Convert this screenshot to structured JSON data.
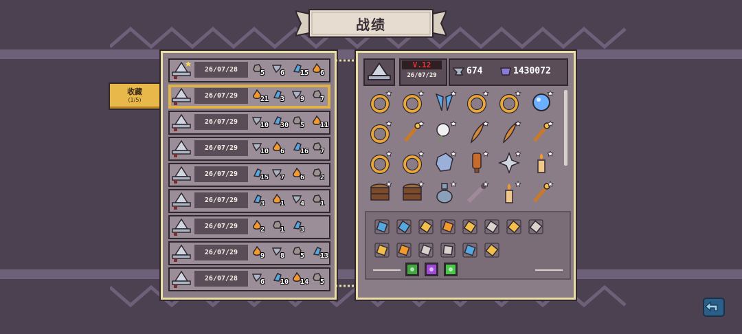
{
  "title": "战绩",
  "favorite_button": {
    "label": "收藏",
    "count": "(1/5)"
  },
  "runs": [
    {
      "date": "26/07/28",
      "starred": true,
      "selected": false,
      "resources": [
        {
          "type": "ore",
          "count": "5"
        },
        {
          "type": "iron",
          "count": "6"
        },
        {
          "type": "crystal",
          "count": "15"
        },
        {
          "type": "fire",
          "count": "6"
        }
      ]
    },
    {
      "date": "26/07/29",
      "starred": false,
      "selected": true,
      "resources": [
        {
          "type": "fire",
          "count": "21"
        },
        {
          "type": "crystal",
          "count": "3"
        },
        {
          "type": "iron",
          "count": "9"
        },
        {
          "type": "ore",
          "count": "7"
        }
      ]
    },
    {
      "date": "26/07/29",
      "starred": false,
      "selected": false,
      "resources": [
        {
          "type": "iron",
          "count": "10"
        },
        {
          "type": "crystal",
          "count": "30"
        },
        {
          "type": "ore",
          "count": "5"
        },
        {
          "type": "fire",
          "count": "11"
        }
      ]
    },
    {
      "date": "26/07/29",
      "starred": false,
      "selected": false,
      "resources": [
        {
          "type": "iron",
          "count": "10"
        },
        {
          "type": "fire",
          "count": "6"
        },
        {
          "type": "crystal",
          "count": "16"
        },
        {
          "type": "ore",
          "count": "7"
        }
      ]
    },
    {
      "date": "26/07/29",
      "starred": false,
      "selected": false,
      "resources": [
        {
          "type": "crystal",
          "count": "15"
        },
        {
          "type": "iron",
          "count": "7"
        },
        {
          "type": "fire",
          "count": "6"
        },
        {
          "type": "ore",
          "count": "2"
        }
      ]
    },
    {
      "date": "26/07/29",
      "starred": false,
      "selected": false,
      "resources": [
        {
          "type": "crystal",
          "count": "3"
        },
        {
          "type": "fire",
          "count": "1"
        },
        {
          "type": "iron",
          "count": "4"
        },
        {
          "type": "ore",
          "count": "1"
        }
      ]
    },
    {
      "date": "26/07/29",
      "starred": false,
      "selected": false,
      "resources": [
        {
          "type": "fire",
          "count": "2"
        },
        {
          "type": "ore",
          "count": "1"
        },
        {
          "type": "crystal",
          "count": "3"
        }
      ]
    },
    {
      "date": "26/07/29",
      "starred": false,
      "selected": false,
      "resources": [
        {
          "type": "fire",
          "count": "9"
        },
        {
          "type": "iron",
          "count": "8"
        },
        {
          "type": "ore",
          "count": "5"
        },
        {
          "type": "crystal",
          "count": "13"
        }
      ]
    },
    {
      "date": "26/07/28",
      "starred": false,
      "selected": false,
      "resources": [
        {
          "type": "iron",
          "count": "6"
        },
        {
          "type": "crystal",
          "count": "10"
        },
        {
          "type": "fire",
          "count": "14"
        },
        {
          "type": "ore",
          "count": "5"
        }
      ]
    }
  ],
  "detail": {
    "version": "V.12",
    "date": "26/07/29",
    "stat1": "674",
    "stat2": "1430072",
    "items": [
      [
        "ring",
        "ring",
        "wings",
        "ring",
        "ring",
        "orb"
      ],
      [
        "ring",
        "staff",
        "cotton",
        "feather",
        "feather",
        "staff"
      ],
      [
        "ring",
        "ring",
        "stone",
        "potion",
        "shuriken",
        "candle"
      ],
      [
        "barrel",
        "barrel",
        "bottle",
        "flute",
        "candle",
        "staff"
      ]
    ],
    "skills_row1": [
      "flask",
      "scroll",
      "arrows",
      "frame",
      "shield",
      "target",
      "down-arrow",
      "box"
    ],
    "skills_row2": [
      "cross",
      "flame",
      "swirl",
      "keys",
      "sword",
      "axe"
    ],
    "gems": [
      "green",
      "purple",
      "green-star"
    ]
  },
  "colors": {
    "fire": "#f29a2e",
    "crystal": "#56a8e0",
    "iron": "#a9b4c4",
    "ore": "#9a9390",
    "gold": "#e8b84a",
    "panel": "#8a7d87"
  }
}
